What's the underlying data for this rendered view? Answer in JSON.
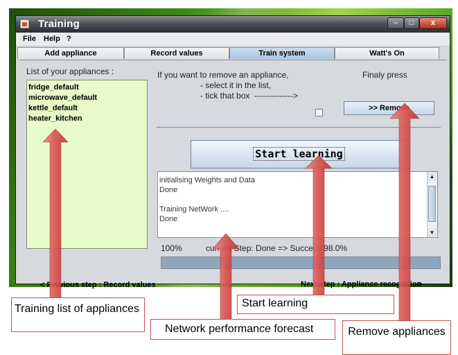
{
  "window": {
    "title": "Training",
    "controls": {
      "minimize": "–",
      "maximize": "□",
      "close": "x"
    }
  },
  "menu": [
    "File",
    "Help",
    "?"
  ],
  "tabs": [
    {
      "label": "Add appliance",
      "active": false
    },
    {
      "label": "Record values",
      "active": false
    },
    {
      "label": "Train system",
      "active": true
    },
    {
      "label": "Watt's On",
      "active": false
    }
  ],
  "appliances": {
    "label": "List of your appliances :",
    "items": [
      "fridge_default",
      "microwave_default",
      "kettle_default",
      "heater_kitchen"
    ]
  },
  "remove": {
    "instruction_line1": "If you want to remove an appliance,",
    "instruction_line2": "- select it in the list,",
    "instruction_line3": "- tick that box  -------------->",
    "final_label": "Finaly press",
    "button_label": ">> Remove"
  },
  "start_button": "Start learning",
  "log": [
    "initialising Weights and Data",
    "Done",
    "",
    "Training NetWork ....",
    "Done"
  ],
  "status": {
    "percent": "100%",
    "text": "current Step: Done => Success:98.0%",
    "progress": 1.0
  },
  "navigation": {
    "previous": "<  Previous step : Record values",
    "next": "Next step : Appliance recognition",
    "next_arrow": ">"
  },
  "annotations": {
    "list": "Training list of appliances",
    "start": "Start learning",
    "network": "Network performance forecast",
    "remove": "Remove appliances"
  },
  "colors": {
    "arrow": "#d9534f",
    "list_bg": "#e6fbc8",
    "active_tab": "#b3cde8",
    "progress_fill": "#8fa6bd"
  }
}
